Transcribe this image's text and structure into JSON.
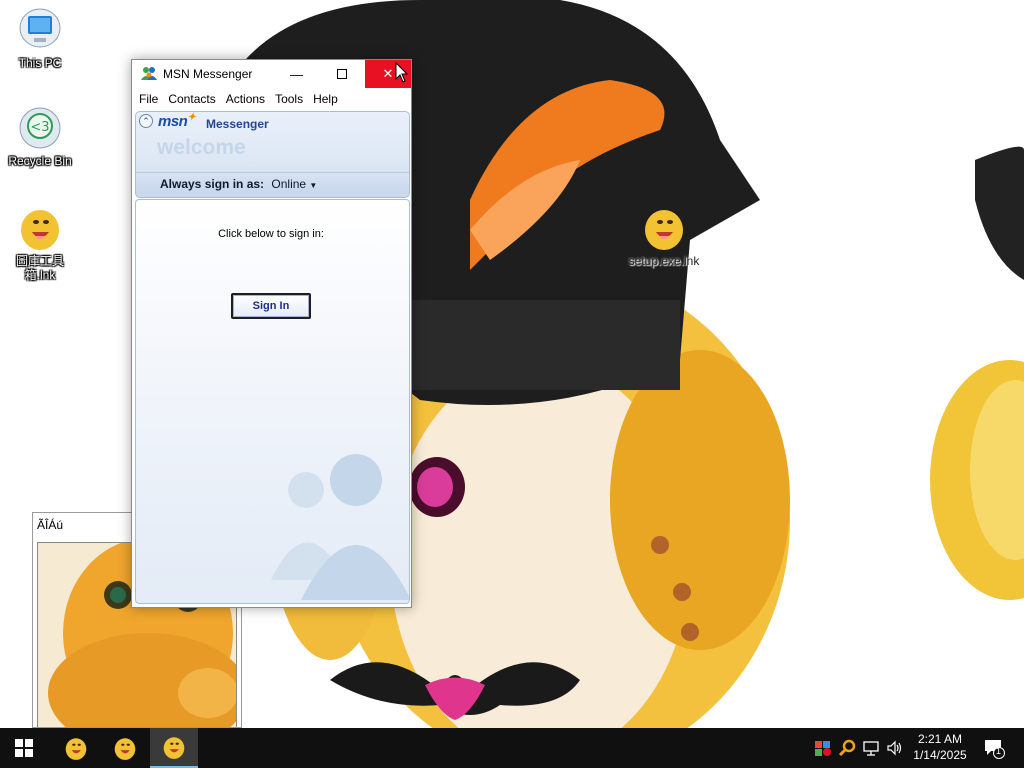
{
  "desktop": {
    "icons": [
      {
        "label": "This PC",
        "icon": "monitor-icon"
      },
      {
        "label": "Recycle Bin",
        "icon": "recycle-bin-icon"
      },
      {
        "label": "圖庫工具箱.lnk",
        "icon": "duck-mascot-icon"
      },
      {
        "label": "setup.exe.lnk",
        "icon": "duck-mascot-icon"
      }
    ]
  },
  "msn_window": {
    "title": "MSN Messenger",
    "menu": [
      "File",
      "Contacts",
      "Actions",
      "Tools",
      "Help"
    ],
    "brand": "msn",
    "product": "Messenger",
    "welcome": "welcome",
    "always_sign_in_label": "Always sign in as:",
    "status_value": "Online",
    "click_below": "Click below to sign in:",
    "sign_in_button": "Sign In",
    "close_color": "#e81123"
  },
  "viewer_window": {
    "title": "ÃÎÁú"
  },
  "taskbar": {
    "apps": [
      {
        "name": "duck-app-1",
        "active": false
      },
      {
        "name": "duck-app-2",
        "active": false
      },
      {
        "name": "duck-app-3",
        "active": true
      }
    ],
    "tray_icons": [
      "network-error-icon",
      "search-tray-icon",
      "network-icon",
      "volume-icon"
    ],
    "time": "2:21 AM",
    "date": "1/14/2025",
    "notification_count": "1"
  }
}
